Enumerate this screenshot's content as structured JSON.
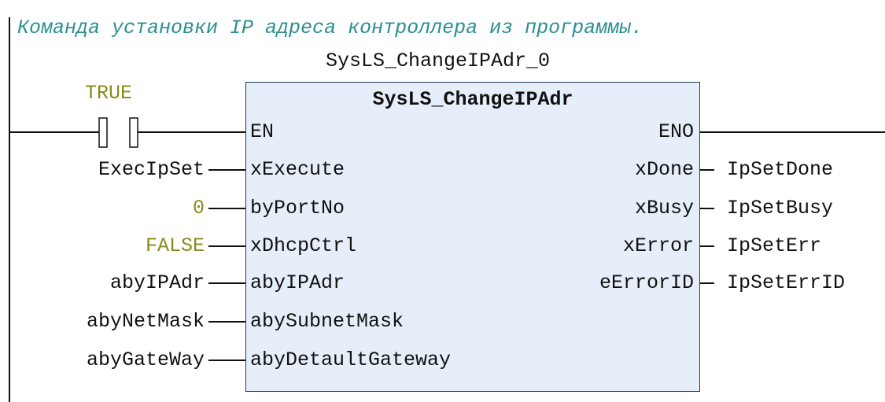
{
  "comment": "Команда установки IP адреса контроллера из программы.",
  "instance_name": "SysLS_ChangeIPAdr_0",
  "block": {
    "type_name": "SysLS_ChangeIPAdr",
    "en": "EN",
    "eno": "ENO",
    "inputs": [
      {
        "pin": "xExecute",
        "value": "ExecIpSet"
      },
      {
        "pin": "byPortNo",
        "value": "0"
      },
      {
        "pin": "xDhcpCtrl",
        "value": "FALSE"
      },
      {
        "pin": "abyIPAdr",
        "value": "abyIPAdr"
      },
      {
        "pin": "abySubnetMask",
        "value": "abyNetMask"
      },
      {
        "pin": "abyDetaultGateway",
        "value": "abyGateWay"
      }
    ],
    "outputs": [
      {
        "pin": "xDone",
        "value": "IpSetDone"
      },
      {
        "pin": "xBusy",
        "value": "IpSetBusy"
      },
      {
        "pin": "xError",
        "value": "IpSetErr"
      },
      {
        "pin": "eErrorID",
        "value": "IpSetErrID"
      }
    ]
  },
  "contact": {
    "label": "TRUE"
  },
  "colors": {
    "comment": "#2a8f8f",
    "constant": "#8a8a1c",
    "block_fill": "#e6eef9",
    "block_border": "#1f3a5a"
  }
}
